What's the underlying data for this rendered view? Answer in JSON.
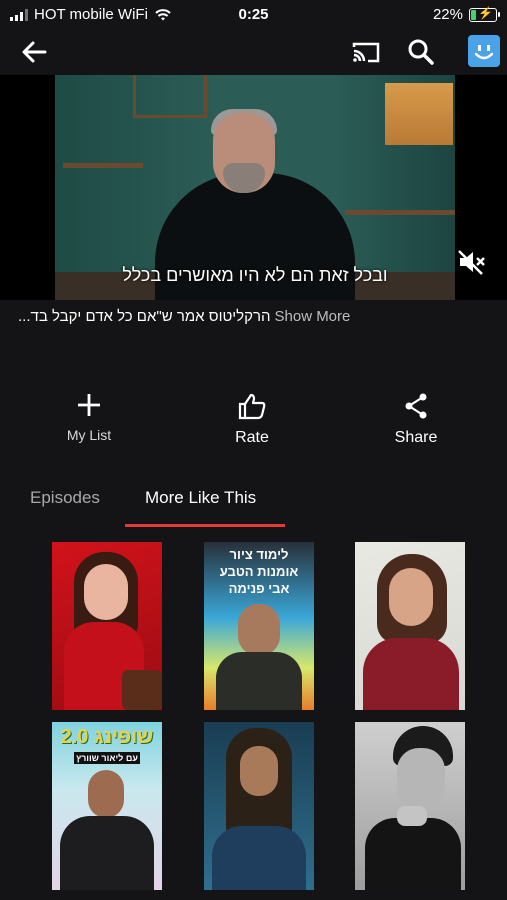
{
  "status_bar": {
    "carrier": "HOT mobile WiFi",
    "time": "0:25",
    "battery": "22%",
    "battery_level": 0.22
  },
  "video": {
    "subtitle": "ובכל זאת הם לא היו מאושרים בכלל"
  },
  "description": {
    "text": "...הרקליטוס אמר ש\"אם כל אדם יקבל בד",
    "show_more": "Show More"
  },
  "actions": {
    "my_list": "My List",
    "rate": "Rate",
    "share": "Share"
  },
  "tabs": {
    "episodes": "Episodes",
    "more_like_this": "More Like This"
  },
  "cards": [
    {
      "caption": ""
    },
    {
      "caption": "לימוד ציור אומנות הטבע אבי פנימה"
    },
    {
      "caption": ""
    },
    {
      "caption": "שופינג 2.0",
      "subcaption": "עם ליאור שוורץ"
    },
    {
      "caption": ""
    },
    {
      "caption": ""
    }
  ],
  "colors": {
    "accent_red": "#e53935",
    "background": "#141416",
    "profile_blue": "#4aa3e8"
  }
}
